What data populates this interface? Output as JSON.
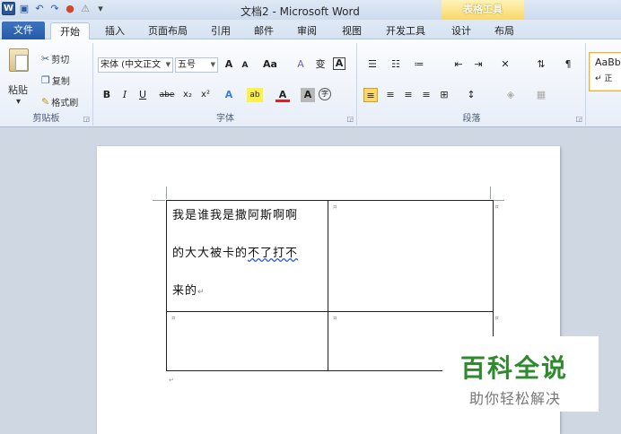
{
  "window": {
    "title": "文档2 - Microsoft Word",
    "context_group": "表格工具"
  },
  "qat": {
    "word_glyph": "W",
    "save_glyph": "▣",
    "undo_glyph": "↶",
    "redo_glyph": "↷",
    "color_glyph": "●",
    "misc_glyph": "⚠",
    "customize_glyph": "▾"
  },
  "tabs": {
    "file": "文件",
    "home": "开始",
    "insert": "插入",
    "layout": "页面布局",
    "references": "引用",
    "mailings": "邮件",
    "review": "审阅",
    "view": "视图",
    "developer": "开发工具",
    "design": "设计",
    "table_layout": "布局"
  },
  "ribbon": {
    "clipboard": {
      "label": "剪贴板",
      "paste": "粘贴",
      "cut": "剪切",
      "copy": "复制",
      "format_painter": "格式刷"
    },
    "font": {
      "label": "字体",
      "font_name": "宋体 (中文正文",
      "font_size": "五号",
      "grow": "A",
      "shrink": "A",
      "change_case": "Aa",
      "clear": "A",
      "phonetic": "变",
      "border": "A",
      "bold": "B",
      "italic": "I",
      "underline": "U",
      "strike": "abe",
      "subscript": "x₂",
      "superscript": "x²",
      "effects": "A",
      "highlight": "ab",
      "font_color": "A",
      "shading": "A",
      "enclose": "字"
    },
    "paragraph": {
      "label": "段落"
    },
    "styles": {
      "preview": "AaBb",
      "name": "↵ 正"
    }
  },
  "document": {
    "cell1_line1": "我是谁我是撒阿斯啊啊",
    "cell1_line2_a": "的大大被卡的",
    "cell1_line2_b": "不了打不",
    "cell1_line3": "来的",
    "para_mark": "↵",
    "cell_mark": "¤"
  },
  "watermark": {
    "title": "百科全说",
    "subtitle": "助你轻松解决"
  }
}
